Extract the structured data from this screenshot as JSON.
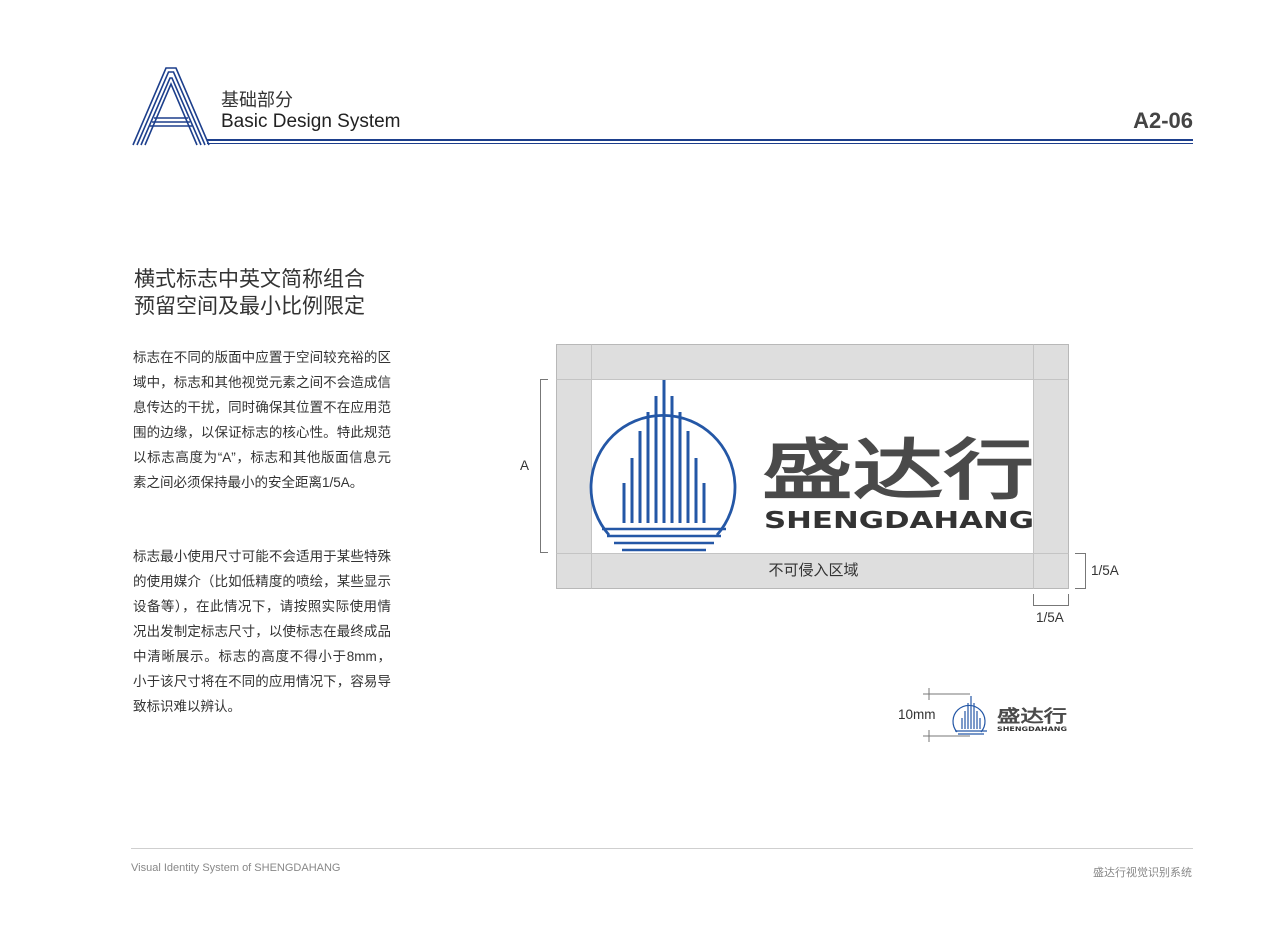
{
  "header": {
    "section_letter": "A",
    "section_title_zh": "基础部分",
    "section_title_en": "Basic Design System",
    "page_number": "A2-06"
  },
  "content": {
    "title_line1": "横式标志中英文简称组合",
    "title_line2": "预留空间及最小比例限定",
    "paragraph1": "标志在不同的版面中应置于空间较充裕的区域中，标志和其他视觉元素之间不会造成信息传达的干扰，同时确保其位置不在应用范围的边缘，以保证标志的核心性。特此规范以标志高度为“A”，标志和其他版面信息元素之间必须保持最小的安全距离1/5A。",
    "paragraph2": "标志最小使用尺寸可能不会适用于某些特殊的使用媒介（比如低精度的喷绘，某些显示设备等），在此情况下，请按照实际使用情况出发制定标志尺寸，以使标志在最终成品中清晰展示。标志的高度不得小于8mm，小于该尺寸将在不同的应用情况下，容易导致标识难以辨认。"
  },
  "diagram": {
    "zone_label": "不可侵入区域",
    "height_label": "A",
    "margin_label_right": "1/5A",
    "margin_label_bottom": "1/5A",
    "min_size_label": "10mm"
  },
  "logo": {
    "name_zh": "盛达行",
    "name_en": "SHENGDAHANG"
  },
  "footer": {
    "left": "Visual Identity System of SHENGDAHANG",
    "right": "盛达行视觉识别系统"
  },
  "colors": {
    "brand_blue": "#2457a6",
    "header_blue": "#1d3f8c",
    "logo_gray": "#4a4a4a",
    "zone_gray": "#dedede"
  }
}
